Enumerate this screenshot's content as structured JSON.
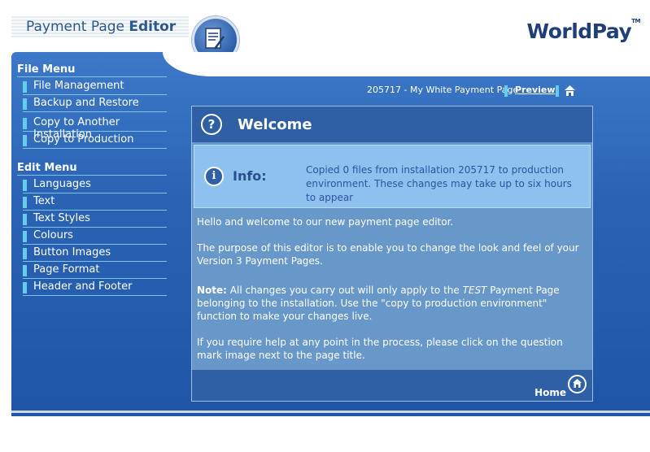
{
  "header": {
    "title_plain": "Payment Page ",
    "title_bold": "Editor",
    "brand": "WorldPay",
    "brand_tm": "TM"
  },
  "sidebar": {
    "file_menu": {
      "heading": "File Menu",
      "items": [
        {
          "label": "File Management"
        },
        {
          "label": "Backup and Restore"
        },
        {
          "label": "Copy to Another Installation"
        },
        {
          "label": "Copy to Production"
        }
      ]
    },
    "edit_menu": {
      "heading": "Edit Menu",
      "items": [
        {
          "label": "Languages"
        },
        {
          "label": "Text"
        },
        {
          "label": "Text Styles"
        },
        {
          "label": "Colours"
        },
        {
          "label": "Button Images"
        },
        {
          "label": "Page Format"
        },
        {
          "label": "Header and Footer"
        }
      ]
    }
  },
  "breadcrumb": {
    "installation": "205717 - My White Payment Page",
    "preview": "Preview"
  },
  "panel": {
    "title": "Welcome",
    "help_icon": "?",
    "info": {
      "icon": "i",
      "label": "Info:",
      "message": "Copied 0 files from installation 205717 to production environment. These changes may take up to six hours to appear"
    },
    "para1": "Hello and welcome to our new payment page editor.",
    "para2": "The purpose of this editor is to enable you to change the look and feel of your Version 3 Payment Pages.",
    "note_label": "Note:",
    "note_text_a": " All changes you carry out will only apply to the ",
    "note_test": "TEST",
    "note_text_b": " Payment Page belonging to the installation. Use the \"copy to production environment\" function to make your changes live.",
    "para4": "If you require help at any point in the process, please click on the question mark image next to the page title.",
    "home": "Home"
  },
  "colors": {
    "main_blue": "#2b63b4",
    "panel_blue": "#6897c9",
    "info_blue": "#8ec1ee",
    "accent": "#66ccee",
    "brand": "#1f3e7a"
  }
}
